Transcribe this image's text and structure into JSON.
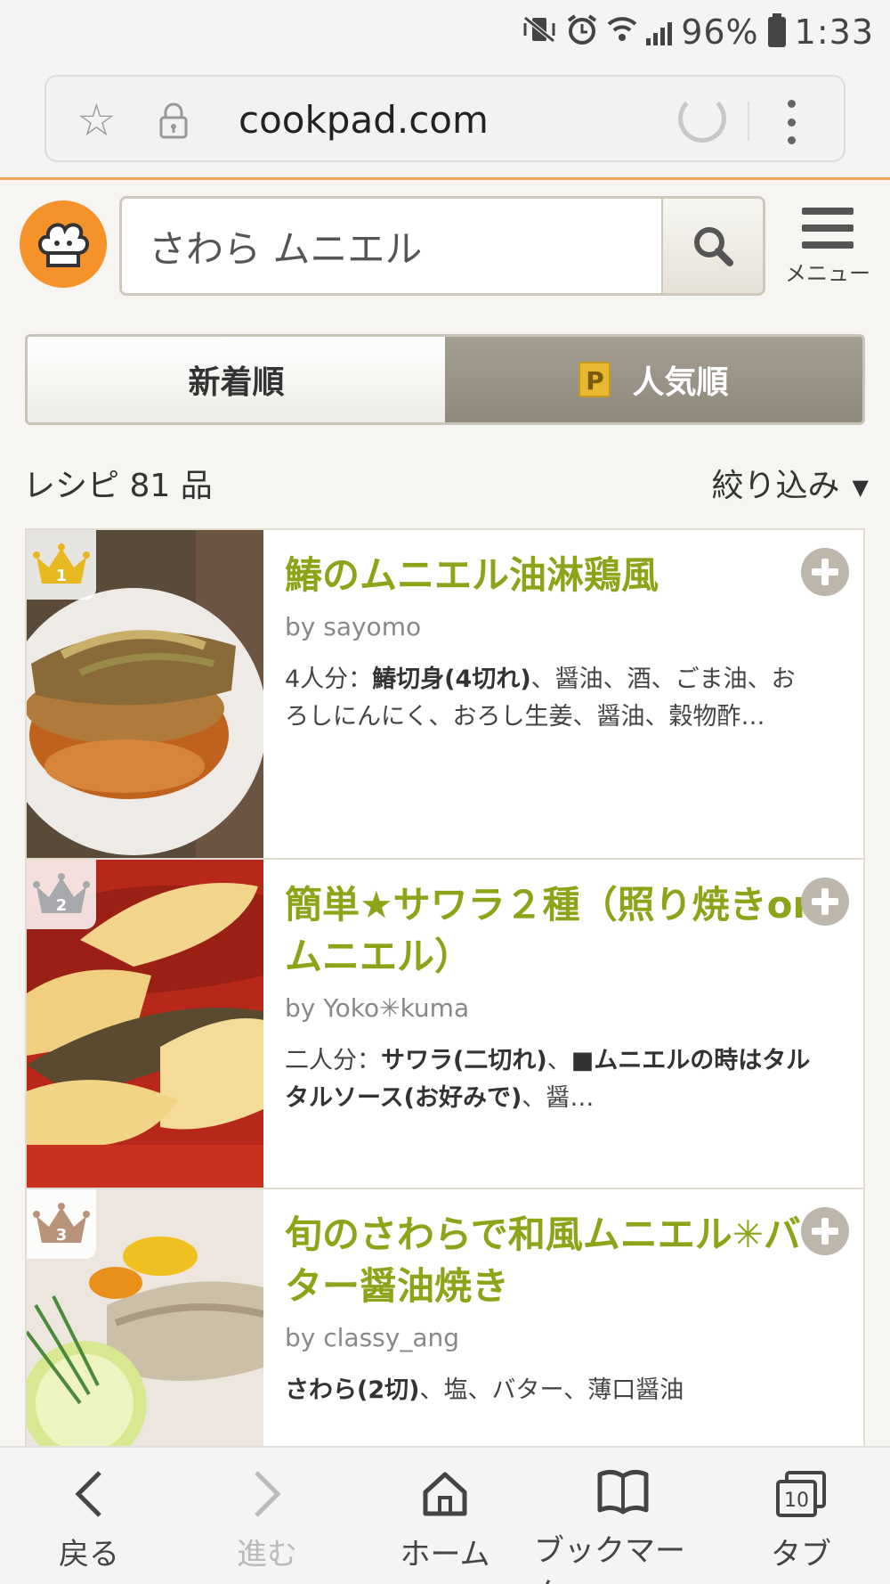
{
  "status_bar": {
    "battery": "96%",
    "time": "1:33"
  },
  "browser": {
    "url": "cookpad.com"
  },
  "header": {
    "search_value": "さわら ムニエル",
    "menu_label": "メニュー"
  },
  "sort_tabs": {
    "newest": "新着順",
    "popular_badge": "P",
    "popular": "人気順"
  },
  "results": {
    "count_text": "レシピ 81 品",
    "filter_label": "絞り込み"
  },
  "recipes": [
    {
      "rank": "1",
      "title": "鰆のムニエル油淋鶏風",
      "author": "by sayomo",
      "servings": "4人分：",
      "ingredients_bold": "鰆切身(4切れ)",
      "ingredients_rest": "、醤油、酒、ごま油、おろしにんにく、おろし生姜、醤油、穀物酢…"
    },
    {
      "rank": "2",
      "title": "簡単★サワラ２種（照り焼きorムニエル）",
      "author": "by Yoko✳kuma",
      "servings": "二人分：",
      "ingredients_bold": "サワラ(二切れ)",
      "ingredients_mid": "、",
      "ingredients_bold2": "■ムニエルの時はタルタルソース(お好みで)",
      "ingredients_rest": "、醤…"
    },
    {
      "rank": "3",
      "title": "旬のさわらで和風ムニエル✳バター醤油焼き",
      "author": "by classy_ang",
      "servings": "",
      "ingredients_bold": "さわら(2切)",
      "ingredients_rest": "、塩、バター、薄口醤油"
    }
  ],
  "bottom_nav": {
    "back": "戻る",
    "forward": "進む",
    "home": "ホーム",
    "bookmarks": "ブックマーク",
    "tabs": "タブ",
    "tab_count": "10"
  },
  "colors": {
    "brand_orange": "#f5922a",
    "title_green": "#8fa319",
    "tab_active": "#9a9488"
  }
}
